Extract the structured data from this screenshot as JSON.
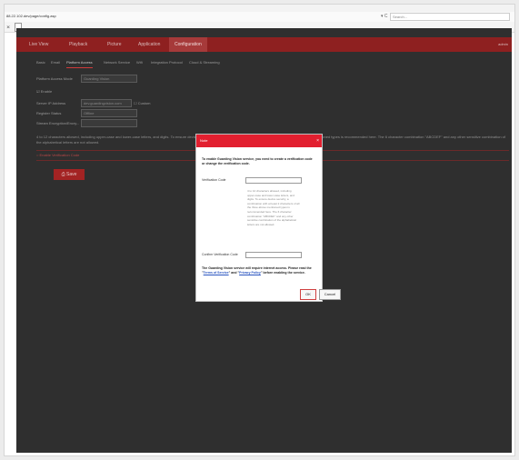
{
  "browser": {
    "url": "88.22.102.dev/page/config.asp",
    "reload_label": "▾ C",
    "search_placeholder": "Search...",
    "tab_label": "✕"
  },
  "app": {
    "nav": [
      {
        "label": "Live View"
      },
      {
        "label": "Playback"
      },
      {
        "label": "Picture"
      },
      {
        "label": "Application"
      },
      {
        "label": "Configuration"
      }
    ],
    "nav_right": "admin",
    "subtabs": [
      {
        "label": "Basic"
      },
      {
        "label": "Email"
      },
      {
        "label": "Platform Access"
      },
      {
        "label": "Network Service"
      },
      {
        "label": "Wifi"
      },
      {
        "label": "Integration Protocol"
      },
      {
        "label": "Cloud & Streaming"
      }
    ],
    "form": {
      "platform_mode_label": "Platform Access Mode",
      "platform_mode_value": "Guarding Vision",
      "enable_label": "Enable",
      "server_ip_label": "Server IP Address",
      "server_ip_value": "dev.guardingvision.com",
      "custom_label": "Custom",
      "register_status_label": "Register Status",
      "register_status_value": "Offline",
      "verification_code_label": "Stream Encryption/Encry...",
      "note": "4 to 12 characters allowed, including upper-case and lower-case letters, and digits. To ensure device security, a combination with at least 2 characters of all the three above mentioned types is recommended here. The 6 character combination \"ABCDEF\" and any other sensitive combination of the alphabetical letters are not allowed.",
      "section_label": "Enable Verification Code",
      "save_label": "Save"
    }
  },
  "dialog": {
    "title": "Note",
    "close_icon": "×",
    "intro": "To enable Guarding Vision service, you need to create a verification code or change the verification code.",
    "verification_code_label": "Verification Code",
    "hint": "4 to 12 characters allowed, including upper-case and lower-case letters, and digits. To ensure device security, a combination with at least 2 characters of all the three above mentioned types is recommended here. The 6 character combination \"ABCDEF\" and any other sensitive combination of the alphabetical letters are not allowed.",
    "confirm_label": "Confirm Verification Code",
    "notice_prefix": "The Guarding Vision service will require internet access. Please read the \"",
    "terms_link": "Terms of Service",
    "notice_middle": "\" and \"",
    "privacy_link": "Privacy Policy",
    "notice_suffix": "\" before enabling the service.",
    "ok_label": "OK",
    "cancel_label": "Cancel"
  },
  "colors": {
    "nav_bar": "#8e2020",
    "dialog_header": "#e21f2f",
    "save_button": "#a32323",
    "link": "#2a55c0"
  }
}
